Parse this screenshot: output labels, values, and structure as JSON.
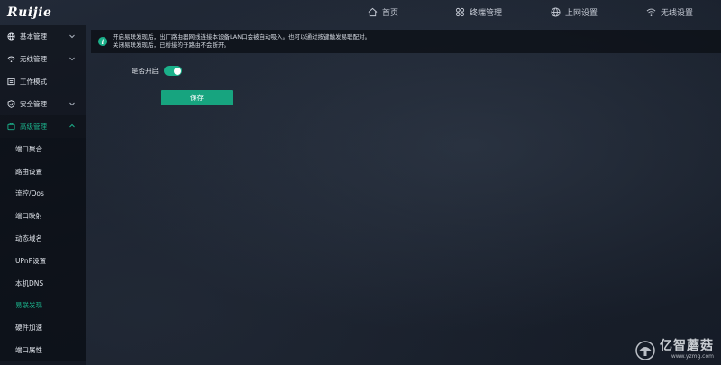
{
  "brand": {
    "logo_text": "Ruijie"
  },
  "top_nav": {
    "home": "首页",
    "terminal": "终端管理",
    "internet": "上网设置",
    "wireless": "无线设置"
  },
  "sidebar": {
    "groups": [
      {
        "label": "基本管理",
        "icon": "globe-icon"
      },
      {
        "label": "无线管理",
        "icon": "wifi-icon"
      },
      {
        "label": "工作模式",
        "icon": "mode-icon"
      },
      {
        "label": "安全管理",
        "icon": "shield-icon"
      },
      {
        "label": "高级管理",
        "icon": "advanced-icon"
      }
    ],
    "sub_items": [
      "端口聚合",
      "路由设置",
      "流控/Qos",
      "端口映射",
      "动态域名",
      "UPnP设置",
      "本机DNS",
      "易联发现",
      "硬件加速",
      "端口属性"
    ],
    "active_sub_item": "易联发现"
  },
  "notice": {
    "line1": "开启易联发现后，出厂路由器网线连接本设备LAN口会被自动吸入。也可以通过按键触发易联配对。",
    "line2": "关闭易联发现后，已桥接的子路由不会断开。"
  },
  "form": {
    "enable_label": "是否开启",
    "enabled": true,
    "save_label": "保存"
  },
  "watermark": {
    "title": "亿智蘑菇",
    "url": "www.yzmg.com"
  },
  "colors": {
    "accent": "#1bb08a",
    "background": "#1b2230"
  }
}
